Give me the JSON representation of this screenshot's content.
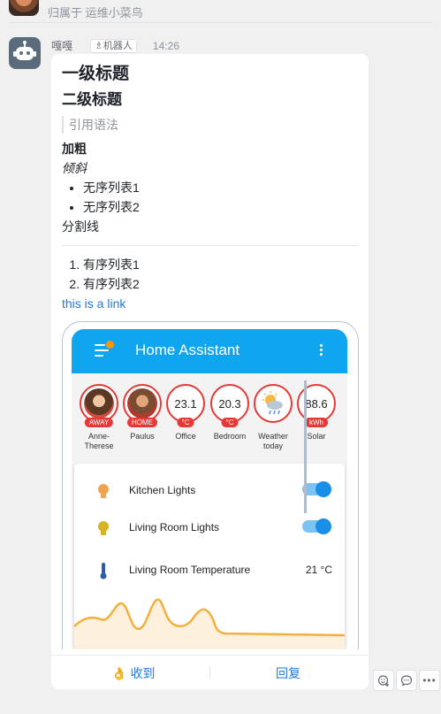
{
  "top": {
    "belongs_text": "归属于 运维小菜鸟"
  },
  "message": {
    "sender": "嘎嘎",
    "robot_tag": "机器人",
    "time": "14:26"
  },
  "markdown": {
    "h1": "一级标题",
    "h2": "二级标题",
    "quote": "引用语法",
    "bold": "加粗",
    "italic": "倾斜",
    "unordered": [
      "无序列表1",
      "无序列表2"
    ],
    "divider_text": "分割线",
    "ordered": [
      "有序列表1",
      "有序列表2"
    ],
    "link": "this is a link"
  },
  "home_assistant": {
    "title": "Home Assistant",
    "badges": [
      {
        "label": "Anne-Therese",
        "pill": "AWAY",
        "type": "person"
      },
      {
        "label": "Paulus",
        "pill": "HOME",
        "type": "person"
      },
      {
        "label": "Office",
        "value": "23.1",
        "pill": "°C",
        "type": "value"
      },
      {
        "label": "Bedroom",
        "value": "20.3",
        "pill": "°C",
        "type": "value"
      },
      {
        "label": "Weather today",
        "type": "weather"
      },
      {
        "label": "Solar",
        "value": "88.6",
        "pill": "kWh",
        "type": "value"
      }
    ],
    "entities": [
      {
        "name": "Kitchen Lights",
        "icon": "lightbulb-orange-icon",
        "state": "on"
      },
      {
        "name": "Living Room Lights",
        "icon": "lightbulb-yellow-icon",
        "state": "on"
      },
      {
        "name": "Living Room Temperature",
        "icon": "thermometer-icon",
        "value": "21 °C"
      }
    ],
    "colors": {
      "bar": "#10a6ef",
      "badge_ring": "#e53935",
      "toggle": "#1a8fe8",
      "graph": "#f4b03d"
    }
  },
  "footer": {
    "ack": "收到",
    "reply": "回复"
  }
}
